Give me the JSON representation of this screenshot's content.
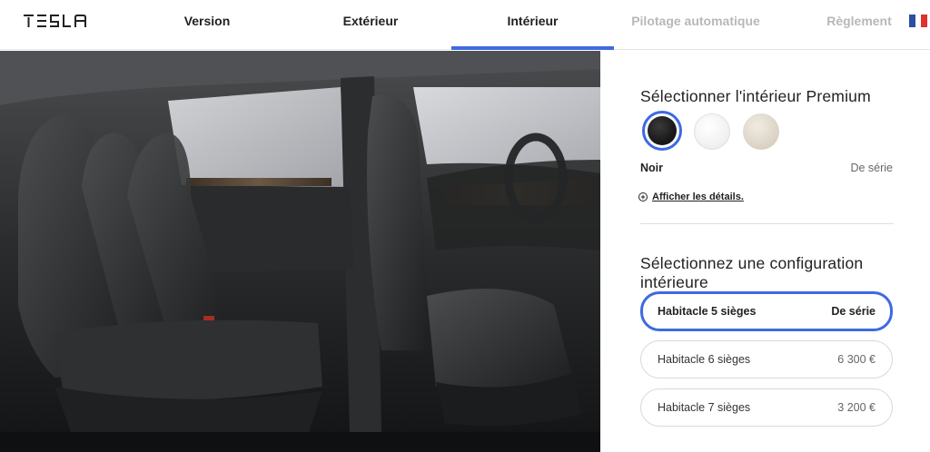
{
  "header": {
    "logo_text": "TESLA",
    "nav": [
      {
        "label": "Version",
        "state": "done"
      },
      {
        "label": "Extérieur",
        "state": "done"
      },
      {
        "label": "Intérieur",
        "state": "active"
      },
      {
        "label": "Pilotage automatique",
        "state": "disabled"
      },
      {
        "label": "Règlement",
        "state": "disabled"
      }
    ],
    "language_flag": "france-flag-icon",
    "accent_color": "#3e6ae1"
  },
  "main": {
    "image_semantic": "interior-photo-black-seats"
  },
  "panel": {
    "interior_title": "Sélectionner l'intérieur Premium",
    "swatches": [
      {
        "name": "Noir",
        "color": "#1a1a1a",
        "selected": true
      },
      {
        "name": "Blanc",
        "color": "#f2f2f2",
        "selected": false
      },
      {
        "name": "Crème",
        "color": "#ddd5c8",
        "selected": false
      }
    ],
    "selected_color_name": "Noir",
    "selected_color_price": "De série",
    "details_link": "Afficher les détails.",
    "config_title": "Sélectionnez une configuration intérieure",
    "options": [
      {
        "label": "Habitacle 5 sièges",
        "price": "De série",
        "selected": true
      },
      {
        "label": "Habitacle 6 sièges",
        "price": "6 300 €",
        "selected": false
      },
      {
        "label": "Habitacle 7 sièges",
        "price": "3 200 €",
        "selected": false
      }
    ]
  }
}
